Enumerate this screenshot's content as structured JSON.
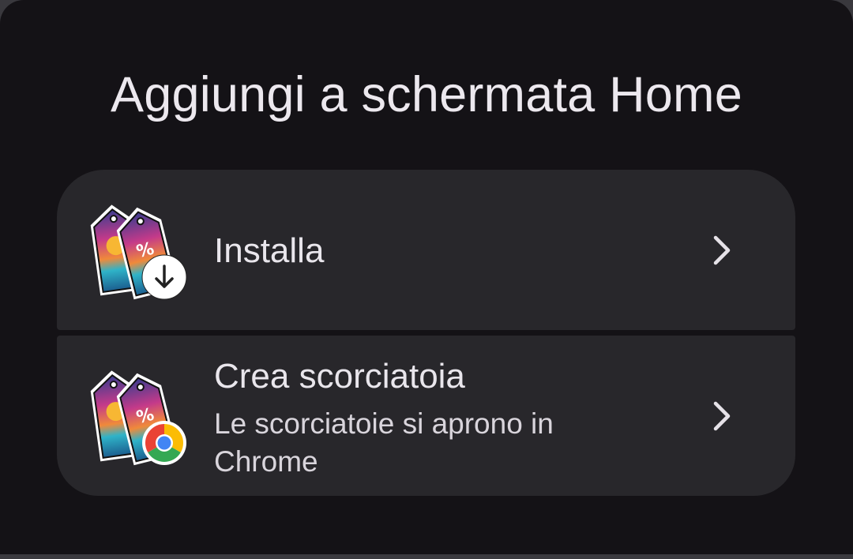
{
  "dialog": {
    "title": "Aggiungi a schermata Home"
  },
  "options": [
    {
      "label": "Installa",
      "icon": "app-icon-with-download-badge",
      "chevron": "chevron-right-icon"
    },
    {
      "label": "Crea scorciatoia",
      "sublabel": "Le scorciatoie si aprono in Chrome",
      "icon": "app-icon-with-chrome-badge",
      "chevron": "chevron-right-icon"
    }
  ],
  "colors": {
    "background": "#141216",
    "card": "#28272b",
    "text": "#e9e6ec"
  }
}
